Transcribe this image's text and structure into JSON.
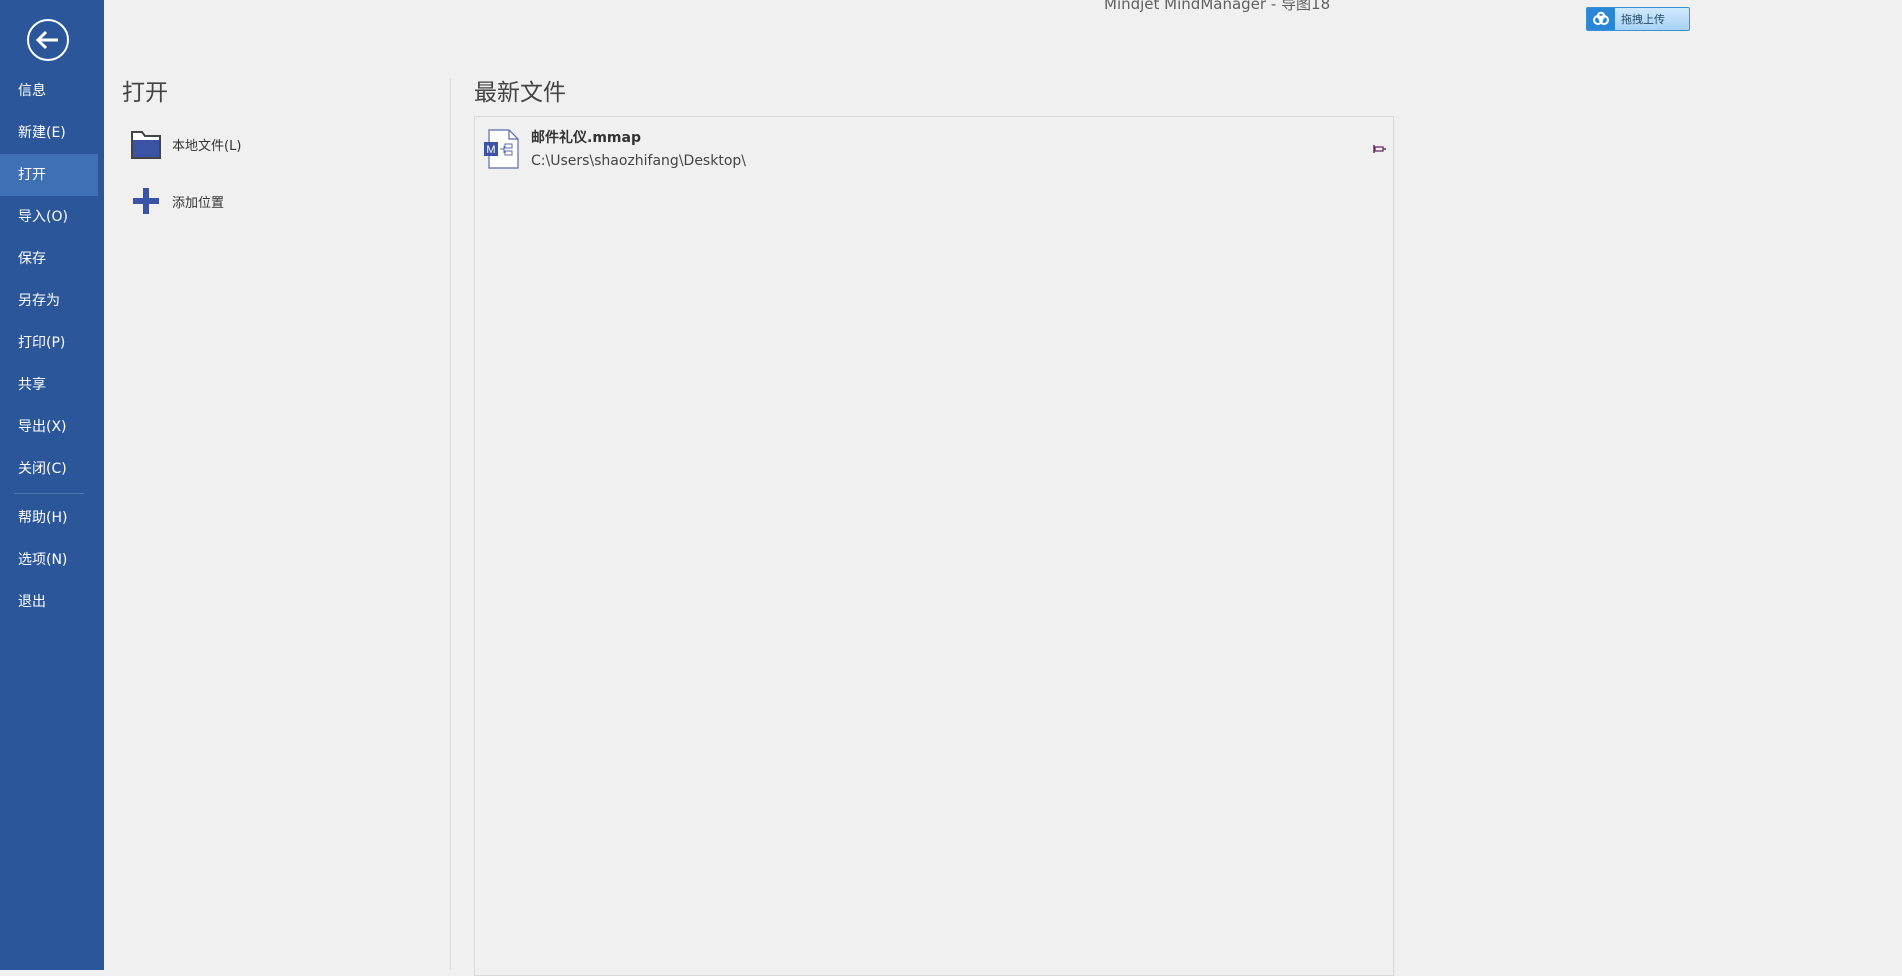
{
  "window": {
    "title": "Mindjet MindManager - 导图18"
  },
  "upload_widget": {
    "icon": "cloud-icon",
    "label": "拖拽上传"
  },
  "sidebar": {
    "back_icon": "back-arrow-icon",
    "items": [
      {
        "label": "信息",
        "active": false
      },
      {
        "label": "新建(E)",
        "active": false
      },
      {
        "label": "打开",
        "active": true
      },
      {
        "label": "导入(O)",
        "active": false
      },
      {
        "label": "保存",
        "active": false
      },
      {
        "label": "另存为",
        "active": false
      },
      {
        "label": "打印(P)",
        "active": false
      },
      {
        "label": "共享",
        "active": false
      },
      {
        "label": "导出(X)",
        "active": false
      },
      {
        "label": "关闭(C)",
        "active": false
      }
    ],
    "bottom_items": [
      {
        "label": "帮助(H)"
      },
      {
        "label": "选项(N)"
      },
      {
        "label": "退出"
      }
    ]
  },
  "open_panel": {
    "title": "打开",
    "locations": [
      {
        "label": "本地文件(L)",
        "icon": "folder-icon"
      },
      {
        "label": "添加位置",
        "icon": "plus-icon"
      }
    ]
  },
  "recent": {
    "title": "最新文件",
    "files": [
      {
        "name": "邮件礼仪.mmap",
        "path": "C:\\Users\\shaozhifang\\Desktop\\",
        "icon": "mmap-file-icon",
        "pin_icon": "pin-icon"
      }
    ]
  },
  "colors": {
    "sidebar_bg": "#2b579a",
    "sidebar_active": "#3f6fb5",
    "content_bg": "#f0f0f0",
    "icon_blue": "#3a53a4"
  }
}
